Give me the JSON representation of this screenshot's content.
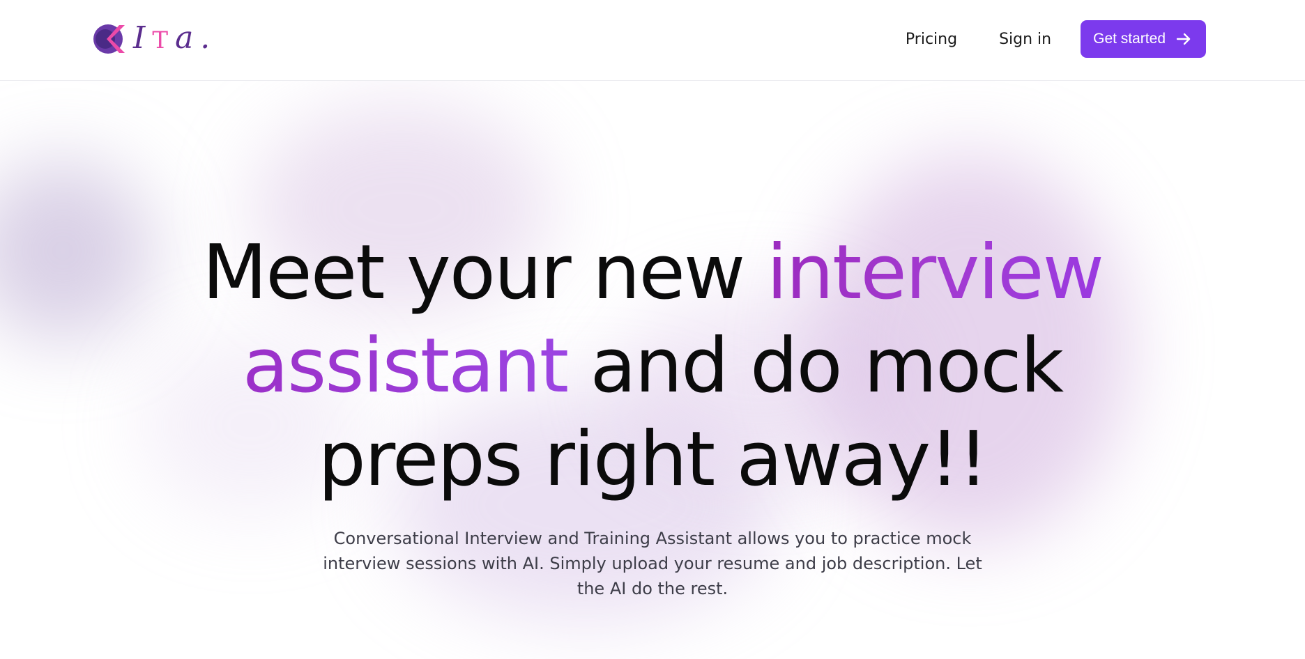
{
  "brand": {
    "name": "CITA.",
    "logo_letters": [
      "I",
      "T",
      "a."
    ],
    "colors": {
      "purple": "#5b2d8e",
      "pink": "#ec4aa8"
    }
  },
  "nav": {
    "pricing_label": "Pricing",
    "signin_label": "Sign in",
    "cta_label": "Get started",
    "cta_icon": "arrow-right-icon",
    "cta_color": "#7c3aed"
  },
  "hero": {
    "headline_part1": "Meet your new ",
    "headline_highlight1": "interview",
    "headline_highlight2": "assistant",
    "headline_part2": " and do mock preps right away!!",
    "highlight_color": "#9b2bbf",
    "subtitle": "Conversational Interview and Training Assistant allows you to practice mock interview sessions with AI. Simply upload your resume and job description. Let the AI do the rest."
  }
}
